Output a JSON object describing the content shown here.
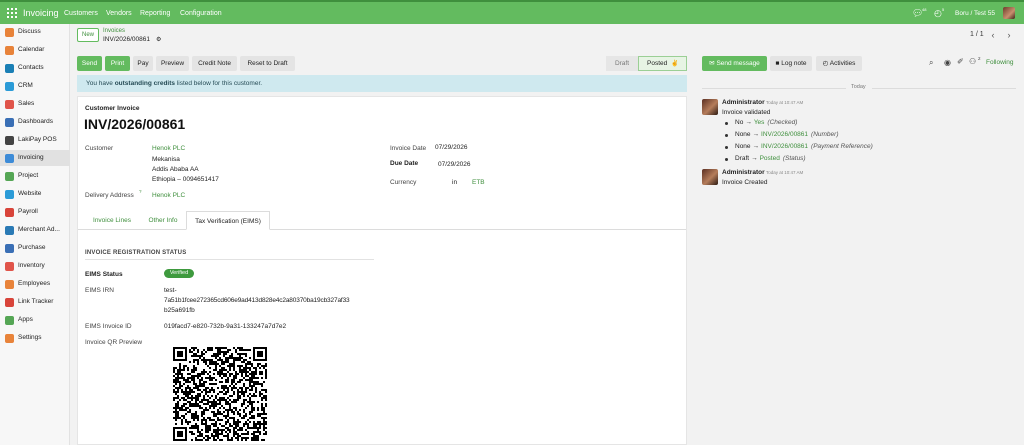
{
  "topbar": {
    "app_name": "Invoicing",
    "menu": [
      "Customers",
      "Vendors",
      "Reporting",
      "Configuration"
    ],
    "messages_count": "48",
    "activities_count": "5",
    "user": "Boru / Test 55"
  },
  "sidebar": {
    "items": [
      {
        "label": "Discuss",
        "color": "#e8833a"
      },
      {
        "label": "Calendar",
        "color": "#e8833a"
      },
      {
        "label": "Contacts",
        "color": "#1a7fb5"
      },
      {
        "label": "CRM",
        "color": "#2b9bd7"
      },
      {
        "label": "Sales",
        "color": "#e0544a"
      },
      {
        "label": "Dashboards",
        "color": "#3a6fb5"
      },
      {
        "label": "LakiPay POS",
        "color": "#444444"
      },
      {
        "label": "Invoicing",
        "color": "#3d8bd7"
      },
      {
        "label": "Project",
        "color": "#55a655"
      },
      {
        "label": "Website",
        "color": "#2b9bd7"
      },
      {
        "label": "Payroll",
        "color": "#d8443a"
      },
      {
        "label": "Merchant Ad...",
        "color": "#2a7ab5"
      },
      {
        "label": "Purchase",
        "color": "#3a6fb5"
      },
      {
        "label": "Inventory",
        "color": "#e0544a"
      },
      {
        "label": "Employees",
        "color": "#e8833a"
      },
      {
        "label": "Link Tracker",
        "color": "#d8443a"
      },
      {
        "label": "Apps",
        "color": "#55a655"
      },
      {
        "label": "Settings",
        "color": "#e8833a"
      }
    ],
    "active_index": 7
  },
  "breadcrumb": {
    "new_label": "New",
    "parent": "Invoices",
    "current": "INV/2026/00861"
  },
  "pager": {
    "value": "1 / 1"
  },
  "actions": {
    "send": "Send",
    "print": "Print",
    "pay": "Pay",
    "preview": "Preview",
    "credit_note": "Credit Note",
    "reset_to_draft": "Reset to Draft"
  },
  "status": {
    "draft": "Draft",
    "posted": "Posted"
  },
  "alert": {
    "prefix": "You have ",
    "bold": "outstanding credits",
    "suffix": " listed below for this customer."
  },
  "invoice": {
    "type_label": "Customer Invoice",
    "number": "INV/2026/00861",
    "customer_label": "Customer",
    "customer_name": "Henok PLC",
    "customer_address_1": "Mekanisa",
    "customer_address_2": "Addis Ababa AA",
    "customer_address_3": "Ethiopia – 0094651417",
    "delivery_label": "Delivery Address",
    "delivery_help": "?",
    "delivery_value": "Henok PLC",
    "invoice_date_label": "Invoice Date",
    "invoice_date": "07/29/2026",
    "due_date_label": "Due Date",
    "due_date": "07/29/2026",
    "currency_label": "Currency",
    "currency_in": "in",
    "currency": "ETB"
  },
  "tabs": [
    {
      "label": "Invoice Lines"
    },
    {
      "label": "Other Info"
    },
    {
      "label": "Tax Verification (EIMS)"
    }
  ],
  "eims": {
    "section_title": "INVOICE REGISTRATION STATUS",
    "status_label": "EIMS Status",
    "status_value": "Verified",
    "irn_label": "EIMS IRN",
    "irn_line1": "test-",
    "irn_line2": "7a51b1fcee272365cd606e9ad413d828e4c2a80370ba19cb327af33",
    "irn_line3": "b25a691fb",
    "invoice_id_label": "EIMS Invoice ID",
    "invoice_id": "019facd7-e820-732b-9a31-133247a7d7e2",
    "qr_label": "Invoice QR Preview"
  },
  "chatter": {
    "send_message": "Send message",
    "log_note": "Log note",
    "activities": "Activities",
    "followers_count": "2",
    "following": "Following",
    "day_label": "Today",
    "messages": [
      {
        "author": "Administrator",
        "time": "Today at 10:47 AM",
        "body": "Invoice validated",
        "tracking": [
          {
            "old": "No",
            "new": "Yes",
            "field": "(Checked)"
          },
          {
            "old": "None",
            "new": "INV/2026/00861",
            "field": "(Number)"
          },
          {
            "old": "None",
            "new": "INV/2026/00861",
            "field": "(Payment Reference)"
          },
          {
            "old": "Draft",
            "new": "Posted",
            "field": "(Status)"
          }
        ]
      },
      {
        "author": "Administrator",
        "time": "Today at 10:47 AM",
        "body": "Invoice Created"
      }
    ]
  },
  "colors": {
    "accent": "#63bb5f",
    "link": "#3f8f3d",
    "alert_bg": "#cfe9ef"
  }
}
